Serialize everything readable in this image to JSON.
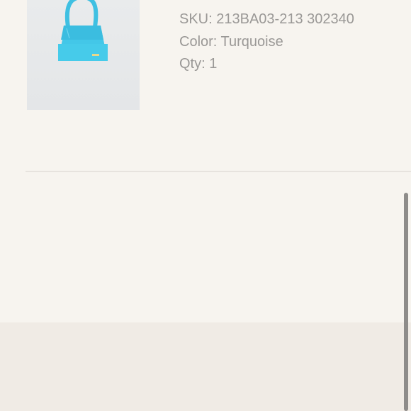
{
  "product": {
    "image_alt": "Turquoise handbag",
    "sku_line": "SKU: 213BA03-213 302340",
    "color_line": "Color: Turquoise",
    "qty_line": "Qty: 1"
  },
  "colors": {
    "page_background": "#f7f4ef",
    "footer_background": "#f0ebe5",
    "detail_text": "#9a9896",
    "bag_turquoise": "#40c4e6"
  }
}
